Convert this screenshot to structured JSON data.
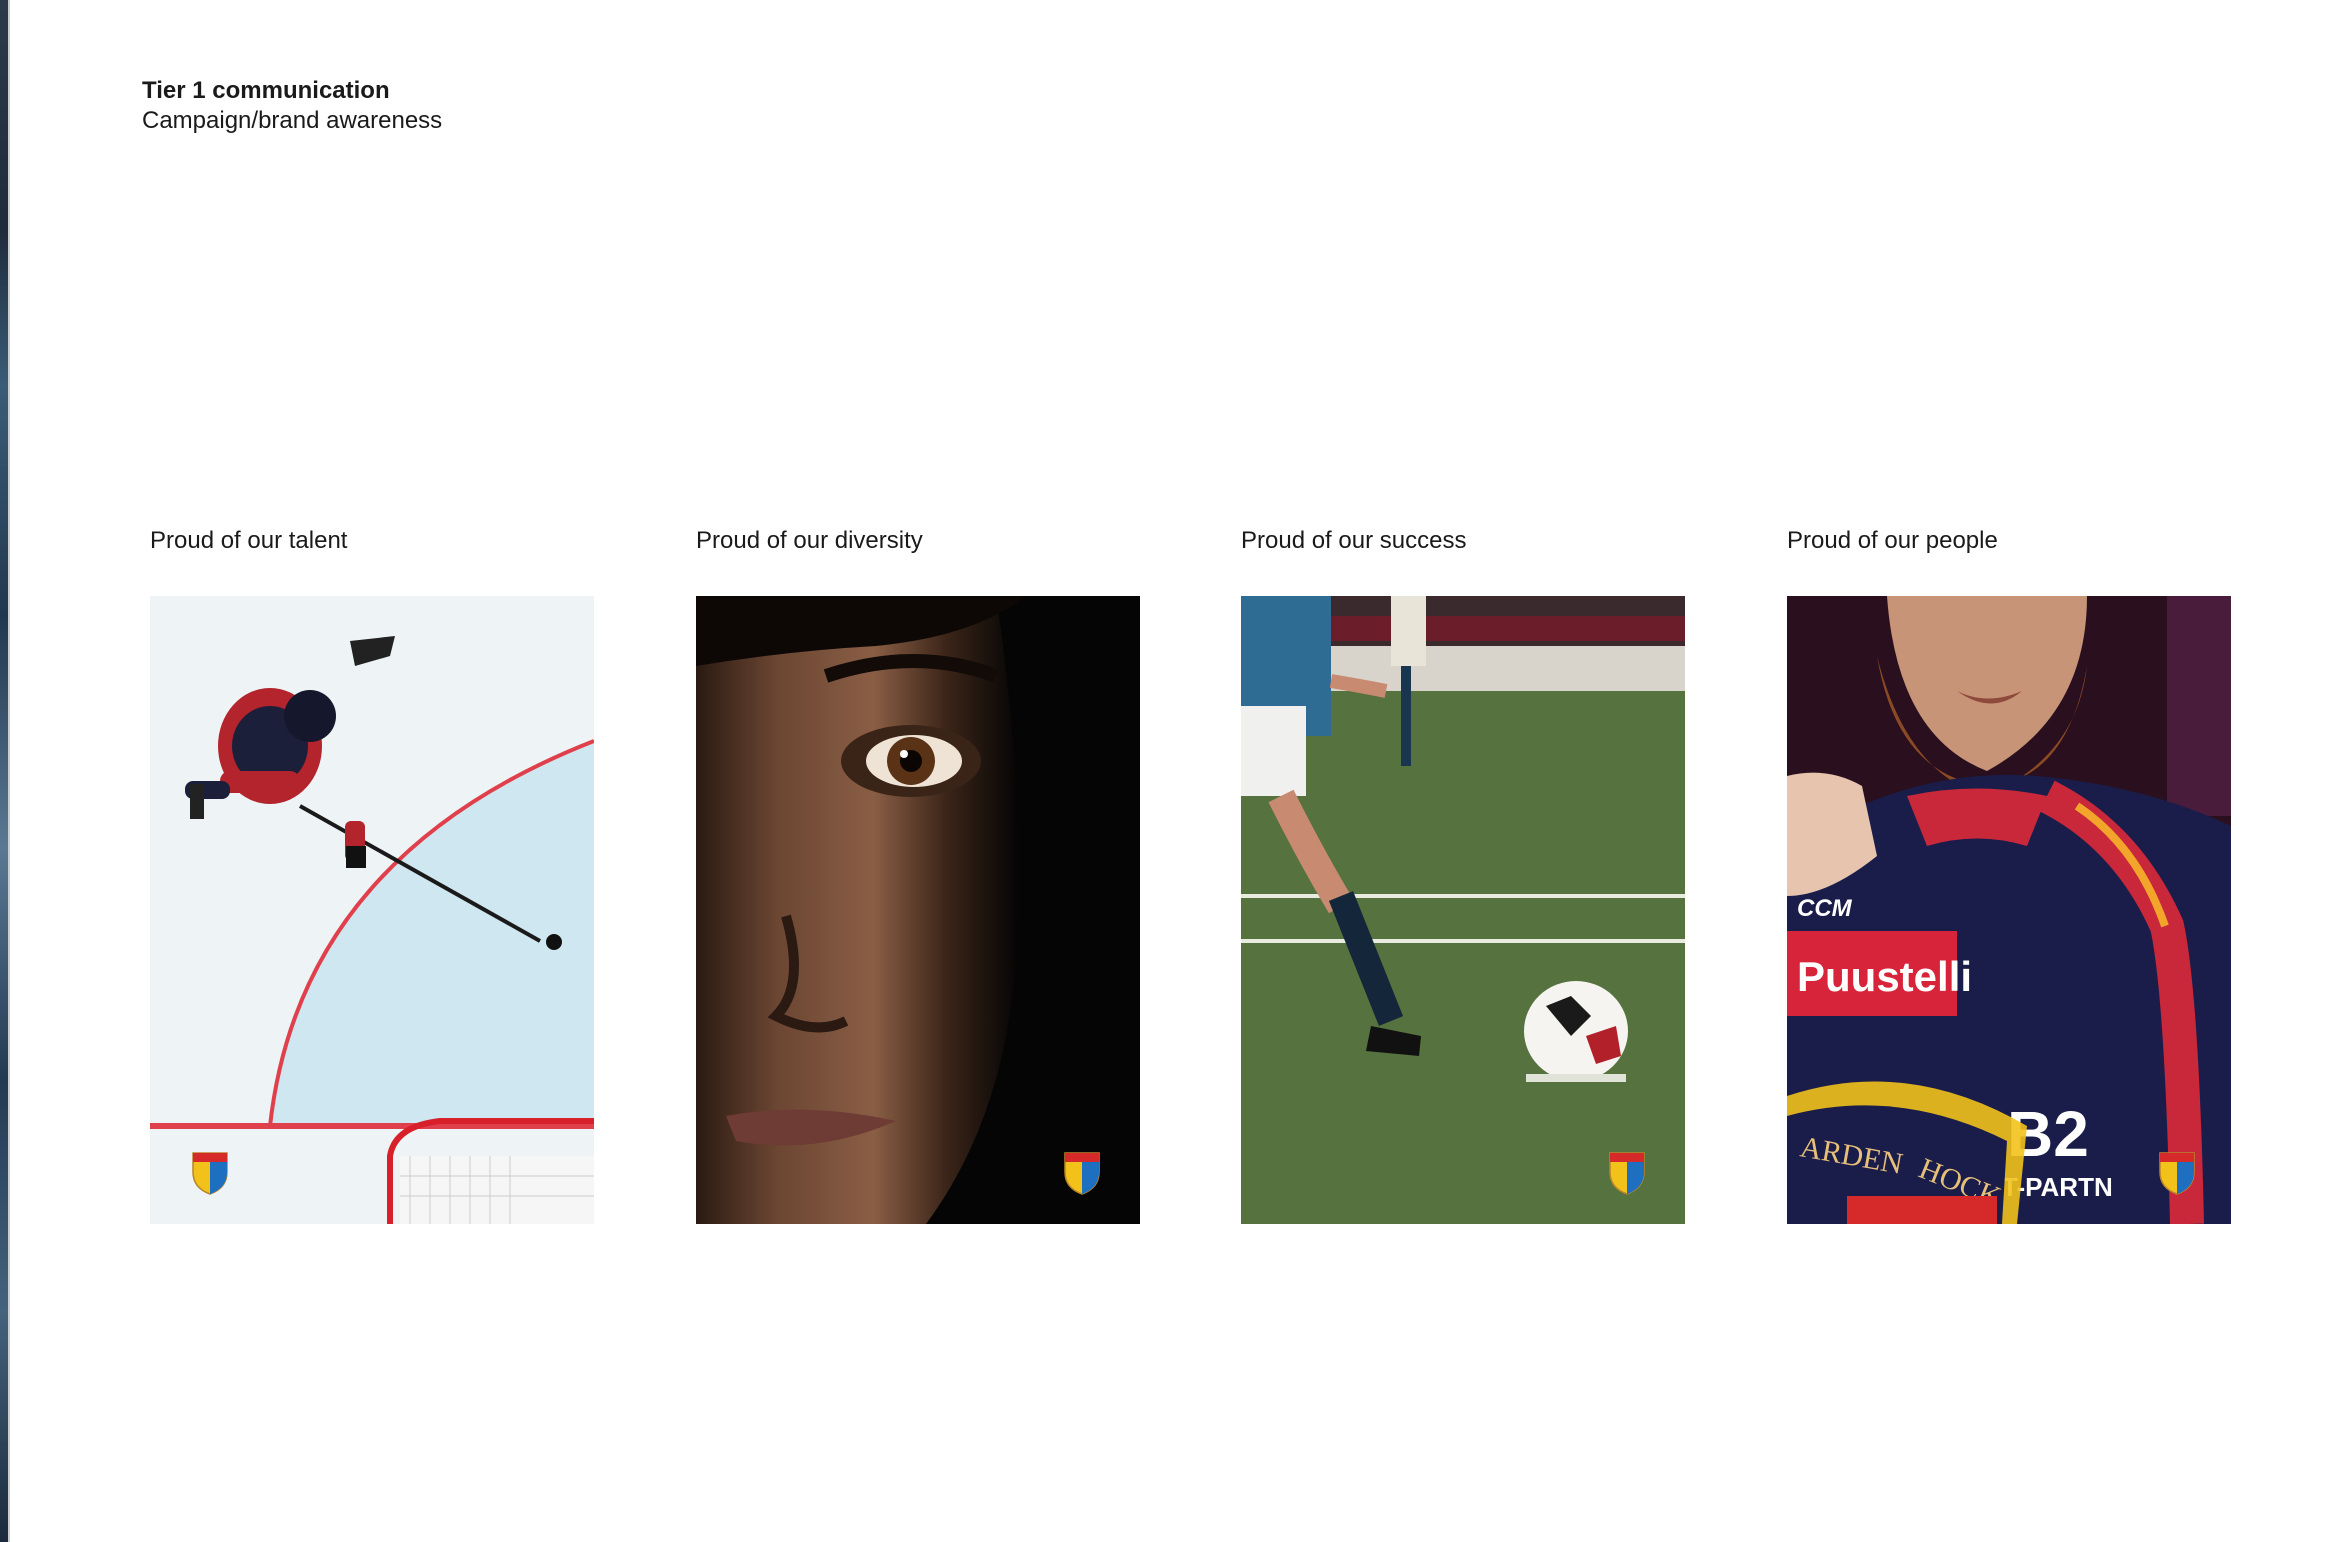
{
  "header": {
    "title": "Tier 1 communication",
    "subtitle": "Campaign/brand awareness"
  },
  "cards": [
    {
      "caption": "Proud of our talent",
      "image": "ice-hockey-player-photo"
    },
    {
      "caption": "Proud of our diversity",
      "image": "face-closeup-photo"
    },
    {
      "caption": "Proud of our success",
      "image": "football-player-photo"
    },
    {
      "caption": "Proud of our people",
      "image": "hockey-jersey-photo"
    }
  ],
  "photo_texts": {
    "sponsor": "Puustelli",
    "brand": "CCM",
    "number": "B2",
    "partner": "T-PARTN",
    "crest_text": "HOCK",
    "crest_arc": "ARDEN"
  },
  "colors": {
    "crest_red": "#d62a2a",
    "crest_yellow": "#f2c21b",
    "crest_blue": "#1e6fbf"
  }
}
